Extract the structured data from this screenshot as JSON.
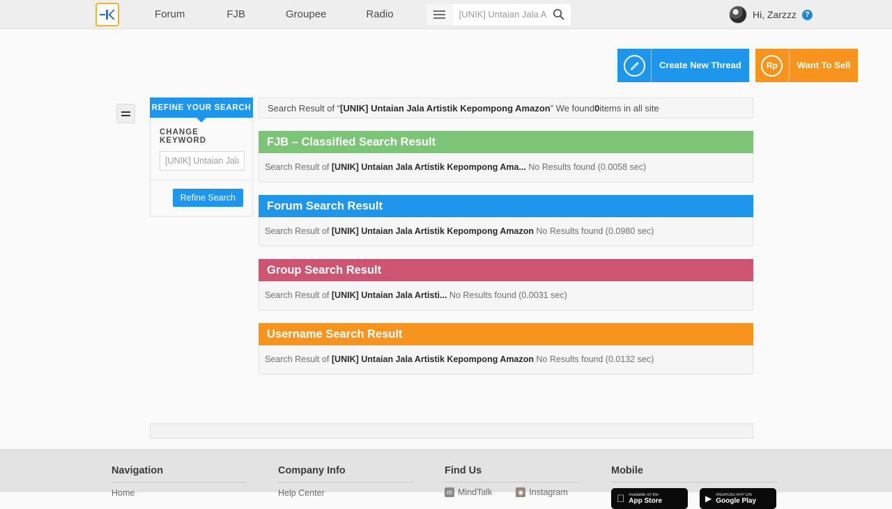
{
  "topnav": {
    "logo_alt": "kaskus-logo",
    "links": [
      {
        "label": "Forum"
      },
      {
        "label": "FJB"
      },
      {
        "label": "Groupee"
      },
      {
        "label": "Radio"
      }
    ],
    "search": {
      "placeholder": "[UNIK] Untaian Jala Artistik Kepompong Amazon",
      "value": ""
    },
    "user": {
      "greeting": "Hi, Zarzzz",
      "help_label": "?"
    }
  },
  "actions": {
    "create_thread": {
      "label": "Create New Thread",
      "icon": "pencil-icon",
      "color": "#1e96ec"
    },
    "want_to_sell": {
      "label": "Want To Sell",
      "icon": "rupiah-icon",
      "glyph": "Rp",
      "color": "#f7941e"
    }
  },
  "sidebar": {
    "tab_label": "REFINE YOUR SEARCH",
    "change_keyword_label": "CHANGE KEYWORD",
    "keyword_input": {
      "placeholder": "[UNIK] Untaian Jala Artistik Kepompong Amazon",
      "value": ""
    },
    "refine_button": "Refine Search"
  },
  "summary": {
    "prefix": "Search Result of “",
    "query": "[UNIK] Untaian Jala Artistik Kepompong Amazon",
    "middle": "” We found ",
    "count": "0",
    "suffix": " items in all site"
  },
  "results": [
    {
      "title": "FJB – Classified Search Result",
      "color": "#7cc576",
      "color_class": "hd-green",
      "body_prefix": "Search Result of ",
      "body_query": "[UNIK] Untaian Jala Artistik Kepompong Ama...",
      "body_status": " No Results found (0.0058 sec)"
    },
    {
      "title": "Forum Search Result",
      "color": "#1e96ec",
      "color_class": "hd-blue",
      "body_prefix": "Search Result of ",
      "body_query": "[UNIK] Untaian Jala Artistik Kepompong Amazon",
      "body_status": " No Results found (0.0980 sec)"
    },
    {
      "title": "Group Search Result",
      "color": "#cd5572",
      "color_class": "hd-pink",
      "body_prefix": "Search Result of ",
      "body_query": "[UNIK] Untaian Jala Artisti...",
      "body_status": " No Results found (0.0031 sec)"
    },
    {
      "title": "Username Search Result",
      "color": "#f7941e",
      "color_class": "hd-orange",
      "body_prefix": "Search Result of ",
      "body_query": "[UNIK] Untaian Jala Artistik Kepompong Amazon",
      "body_status": " No Results found (0.0132 sec)"
    }
  ],
  "footer": {
    "navigation": {
      "title": "Navigation",
      "links": [
        "Home"
      ]
    },
    "company": {
      "title": "Company Info",
      "links": [
        "Help Center"
      ]
    },
    "find_us": {
      "title": "Find Us",
      "items": [
        {
          "label": "MindTalk",
          "icon": "mindtalk-icon"
        },
        {
          "label": "Instagram",
          "icon": "instagram-icon"
        }
      ]
    },
    "mobile": {
      "title": "Mobile",
      "badges": [
        {
          "sub": "Available on the",
          "main": "App Store",
          "icon": "apple-icon"
        },
        {
          "sub": "ANDROID APP ON",
          "main": "Google Play",
          "icon": "play-icon"
        }
      ]
    }
  }
}
